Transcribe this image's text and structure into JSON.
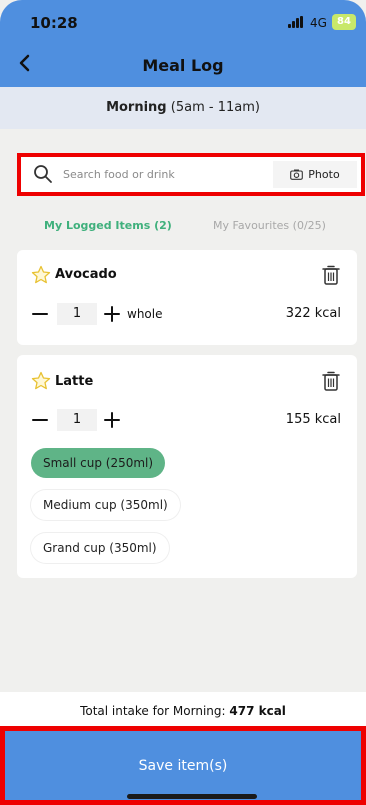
{
  "status_bar": {
    "time": "10:28",
    "network": "4G",
    "battery": "84"
  },
  "header": {
    "title": "Meal Log",
    "back_icon": "chevron-left-icon"
  },
  "session": {
    "name": "Morning",
    "range": "(5am - 11am)"
  },
  "search": {
    "placeholder": "Search food or drink",
    "photo_label": "Photo"
  },
  "tabs": [
    {
      "label": "My Logged Items (2)",
      "active": true
    },
    {
      "label": "My Favourites (0/25)",
      "active": false
    }
  ],
  "items": [
    {
      "name": "Avocado",
      "quantity": "1",
      "unit": "whole",
      "kcal": "322 kcal"
    },
    {
      "name": "Latte",
      "quantity": "1",
      "unit": "",
      "kcal": "155 kcal",
      "sizes": [
        {
          "label": "Small cup (250ml)",
          "selected": true
        },
        {
          "label": "Medium cup (350ml)",
          "selected": false
        },
        {
          "label": "Grand cup (350ml)",
          "selected": false
        }
      ]
    }
  ],
  "total": {
    "prefix": "Total intake for Morning:",
    "value": "477 kcal"
  },
  "save": {
    "label": "Save item(s)"
  },
  "colors": {
    "header_blue": "#4f8fdf",
    "accent_green": "#3fb07c",
    "highlight_red": "#ee0000"
  }
}
